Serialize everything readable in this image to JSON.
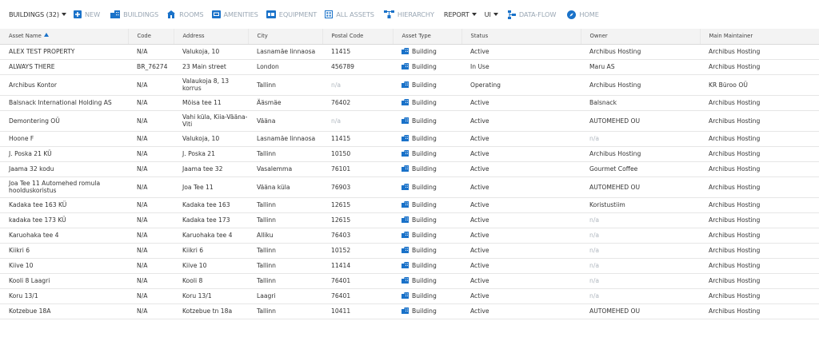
{
  "colors": {
    "accent": "#1a72c9",
    "muted": "#9aa7b4",
    "header_bg": "#f3f3f3"
  },
  "toolbar": {
    "buildings_count": "BUILDINGS (32)",
    "new": "NEW",
    "buildings": "BUILDINGS",
    "rooms": "ROOMS",
    "amenities": "AMENITIES",
    "equipment": "EQUIPMENT",
    "all_assets": "ALL ASSETS",
    "hierarchy": "HIERARCHY",
    "report": "REPORT",
    "ui": "UI",
    "data_flow": "DATA-FLOW",
    "home": "HOME"
  },
  "columns": [
    "Asset Name",
    "Code",
    "Address",
    "City",
    "Postal Code",
    "Asset Type",
    "Status",
    "Owner",
    "Main Maintainer"
  ],
  "rows": [
    {
      "name": "ALEX TEST PROPERTY",
      "code": "N/A",
      "address": "Valukoja, 10",
      "city": "Lasnamäe linnaosa",
      "postal": "11415",
      "type": "Building",
      "status": "Active",
      "owner": "Archibus Hosting",
      "maintainer": "Archibus Hosting"
    },
    {
      "name": "ALWAYS THERE",
      "code": "BR_76274",
      "address": "23 Main street",
      "city": "London",
      "postal": "456789",
      "type": "Building",
      "status": "In Use",
      "owner": "Maru AS",
      "maintainer": "Archibus Hosting"
    },
    {
      "name": "Archibus Kontor",
      "code": "N/A",
      "address": "Valaukoja 8, 13 korrus",
      "city": "Tallinn",
      "postal": "n/a",
      "type": "Building",
      "status": "Operating",
      "owner": "Archibus Hosting",
      "maintainer": "KR Büroo OÜ"
    },
    {
      "name": "Balsnack International Holding AS",
      "code": "N/A",
      "address": "Mõisa tee 11",
      "city": "Ääsmäe",
      "postal": "76402",
      "type": "Building",
      "status": "Active",
      "owner": "Balsnack",
      "maintainer": "Archibus Hosting"
    },
    {
      "name": "Demontering OÜ",
      "code": "N/A",
      "address": "Vahi küla, Kiia-Vääna-Viti",
      "city": "Vääna",
      "postal": "n/a",
      "type": "Building",
      "status": "Active",
      "owner": "AUTOMEHED OU",
      "maintainer": "Archibus Hosting"
    },
    {
      "name": "Hoone F",
      "code": "N/A",
      "address": "Valukoja, 10",
      "city": "Lasnamäe linnaosa",
      "postal": "11415",
      "type": "Building",
      "status": "Active",
      "owner": "n/a",
      "maintainer": "Archibus Hosting"
    },
    {
      "name": "J. Poska 21 KÜ",
      "code": "N/A",
      "address": "J. Poska 21",
      "city": "Tallinn",
      "postal": "10150",
      "type": "Building",
      "status": "Active",
      "owner": "Archibus Hosting",
      "maintainer": "Archibus Hosting"
    },
    {
      "name": "Jaama 32 kodu",
      "code": "N/A",
      "address": "Jaama tee 32",
      "city": "Vasalemma",
      "postal": "76101",
      "type": "Building",
      "status": "Active",
      "owner": "Gourmet Coffee",
      "maintainer": "Archibus Hosting"
    },
    {
      "name": "Joa Tee 11 Automehed romula hoolduskoristus",
      "code": "N/A",
      "address": "Joa Tee 11",
      "city": "Vääna küla",
      "postal": "76903",
      "type": "Building",
      "status": "Active",
      "owner": "AUTOMEHED OU",
      "maintainer": "Archibus Hosting"
    },
    {
      "name": "Kadaka tee 163 KÜ",
      "code": "N/A",
      "address": "Kadaka tee 163",
      "city": "Tallinn",
      "postal": "12615",
      "type": "Building",
      "status": "Active",
      "owner": "Koristustiim",
      "maintainer": "Archibus Hosting"
    },
    {
      "name": "kadaka tee 173 KÜ",
      "code": "N/A",
      "address": "Kadaka tee 173",
      "city": "Tallinn",
      "postal": "12615",
      "type": "Building",
      "status": "Active",
      "owner": "n/a",
      "maintainer": "Archibus Hosting"
    },
    {
      "name": "Karuohaka tee 4",
      "code": "N/A",
      "address": "Karuohaka tee 4",
      "city": "Alliku",
      "postal": "76403",
      "type": "Building",
      "status": "Active",
      "owner": "n/a",
      "maintainer": "Archibus Hosting"
    },
    {
      "name": "Kiikri 6",
      "code": "N/A",
      "address": "Kiikri 6",
      "city": "Tallinn",
      "postal": "10152",
      "type": "Building",
      "status": "Active",
      "owner": "n/a",
      "maintainer": "Archibus Hosting"
    },
    {
      "name": "Kiive 10",
      "code": "N/A",
      "address": "Kiive 10",
      "city": "Tallinn",
      "postal": "11414",
      "type": "Building",
      "status": "Active",
      "owner": "n/a",
      "maintainer": "Archibus Hosting"
    },
    {
      "name": "Kooli 8 Laagri",
      "code": "N/A",
      "address": "Kooli 8",
      "city": "Tallinn",
      "postal": "76401",
      "type": "Building",
      "status": "Active",
      "owner": "n/a",
      "maintainer": "Archibus Hosting"
    },
    {
      "name": "Koru 13/1",
      "code": "N/A",
      "address": "Koru 13/1",
      "city": "Laagri",
      "postal": "76401",
      "type": "Building",
      "status": "Active",
      "owner": "n/a",
      "maintainer": "Archibus Hosting"
    },
    {
      "name": "Kotzebue 18A",
      "code": "N/A",
      "address": "Kotzebue tn 18a",
      "city": "Tallinn",
      "postal": "10411",
      "type": "Building",
      "status": "Active",
      "owner": "AUTOMEHED OU",
      "maintainer": "Archibus Hosting"
    }
  ]
}
